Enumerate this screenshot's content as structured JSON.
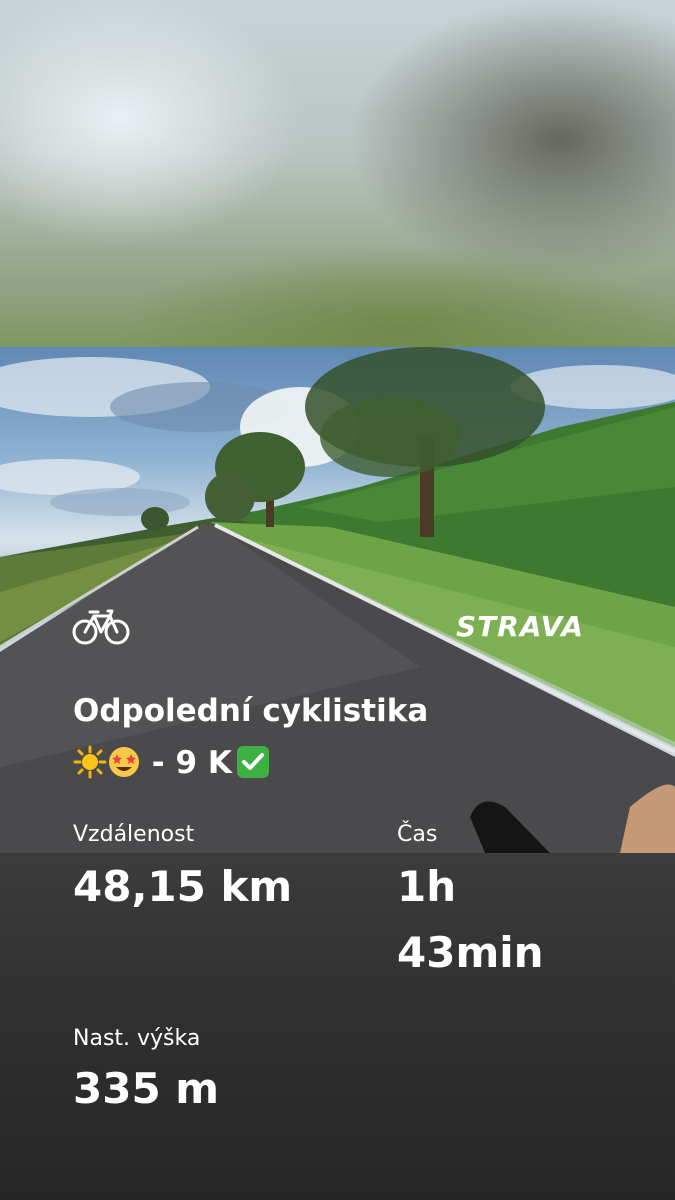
{
  "activity": {
    "title_line1": "Odpolední cyklistika",
    "title_line2_text": " - 9 K",
    "emoji": [
      "sun-emoji",
      "star-struck-emoji",
      "check-mark-emoji"
    ]
  },
  "brand": {
    "logo": "STRAVA"
  },
  "stats": {
    "distance_label": "Vzdálenost",
    "distance_value": "48,15 km",
    "time_label": "Čas",
    "time_value_line1": "1h",
    "time_value_line2": "43min",
    "elevation_label": "Nast. výška",
    "elevation_value": "335 m"
  },
  "icons": {
    "activity_type": "bike-icon"
  },
  "colors": {
    "text": "#ffffff",
    "check": "#3cb043",
    "sun": "#f7b500"
  }
}
